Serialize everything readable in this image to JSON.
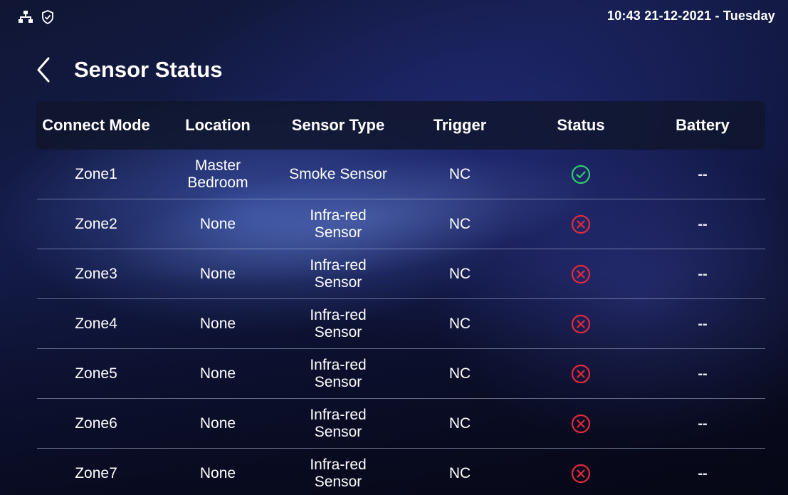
{
  "status_bar": {
    "datetime": "10:43  21-12-2021 - Tuesday",
    "icons": [
      "network-icon",
      "shield-check-icon"
    ]
  },
  "header": {
    "back_icon": "chevron-left-icon",
    "title": "Sensor Status"
  },
  "table": {
    "columns": [
      "Connect Mode",
      "Location",
      "Sensor Type",
      "Trigger",
      "Status",
      "Battery"
    ],
    "rows": [
      {
        "connect_mode": "Zone1",
        "location": "Master Bedroom",
        "sensor_type": "Smoke Sensor",
        "trigger": "NC",
        "status": "check-circle-icon",
        "battery": "--"
      },
      {
        "connect_mode": "Zone2",
        "location": "None",
        "sensor_type": "Infra-red Sensor",
        "trigger": "NC",
        "status": "x-circle-icon",
        "battery": "--"
      },
      {
        "connect_mode": "Zone3",
        "location": "None",
        "sensor_type": "Infra-red Sensor",
        "trigger": "NC",
        "status": "x-circle-icon",
        "battery": "--"
      },
      {
        "connect_mode": "Zone4",
        "location": "None",
        "sensor_type": "Infra-red Sensor",
        "trigger": "NC",
        "status": "x-circle-icon",
        "battery": "--"
      },
      {
        "connect_mode": "Zone5",
        "location": "None",
        "sensor_type": "Infra-red Sensor",
        "trigger": "NC",
        "status": "x-circle-icon",
        "battery": "--"
      },
      {
        "connect_mode": "Zone6",
        "location": "None",
        "sensor_type": "Infra-red Sensor",
        "trigger": "NC",
        "status": "x-circle-icon",
        "battery": "--"
      },
      {
        "connect_mode": "Zone7",
        "location": "None",
        "sensor_type": "Infra-red Sensor",
        "trigger": "NC",
        "status": "x-circle-icon",
        "battery": "--"
      }
    ]
  },
  "colors": {
    "ok": "#2ecc71",
    "error": "#e8283c",
    "text": "#ffffff"
  }
}
